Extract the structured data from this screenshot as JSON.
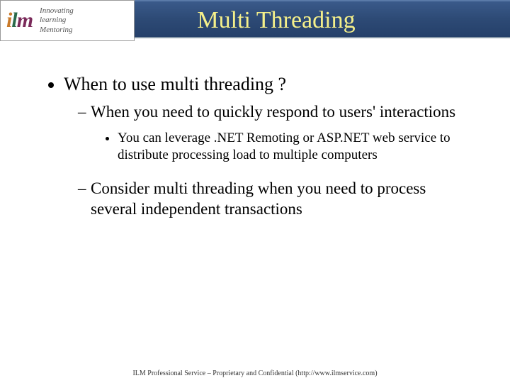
{
  "logo": {
    "tagline1": "Innovating",
    "tagline2": "learning",
    "tagline3": "Mentoring"
  },
  "title": "Multi Threading",
  "bullets": {
    "l1": "When to use multi threading ?",
    "l2a": "When you need to quickly respond to users' interactions",
    "l3a": "You can leverage .NET Remoting or ASP.NET web service to distribute processing load to multiple computers",
    "l2b": "Consider multi threading when you need to process several independent transactions"
  },
  "footer": "ILM Professional Service – Proprietary and Confidential (http://www.ilmservice.com)"
}
